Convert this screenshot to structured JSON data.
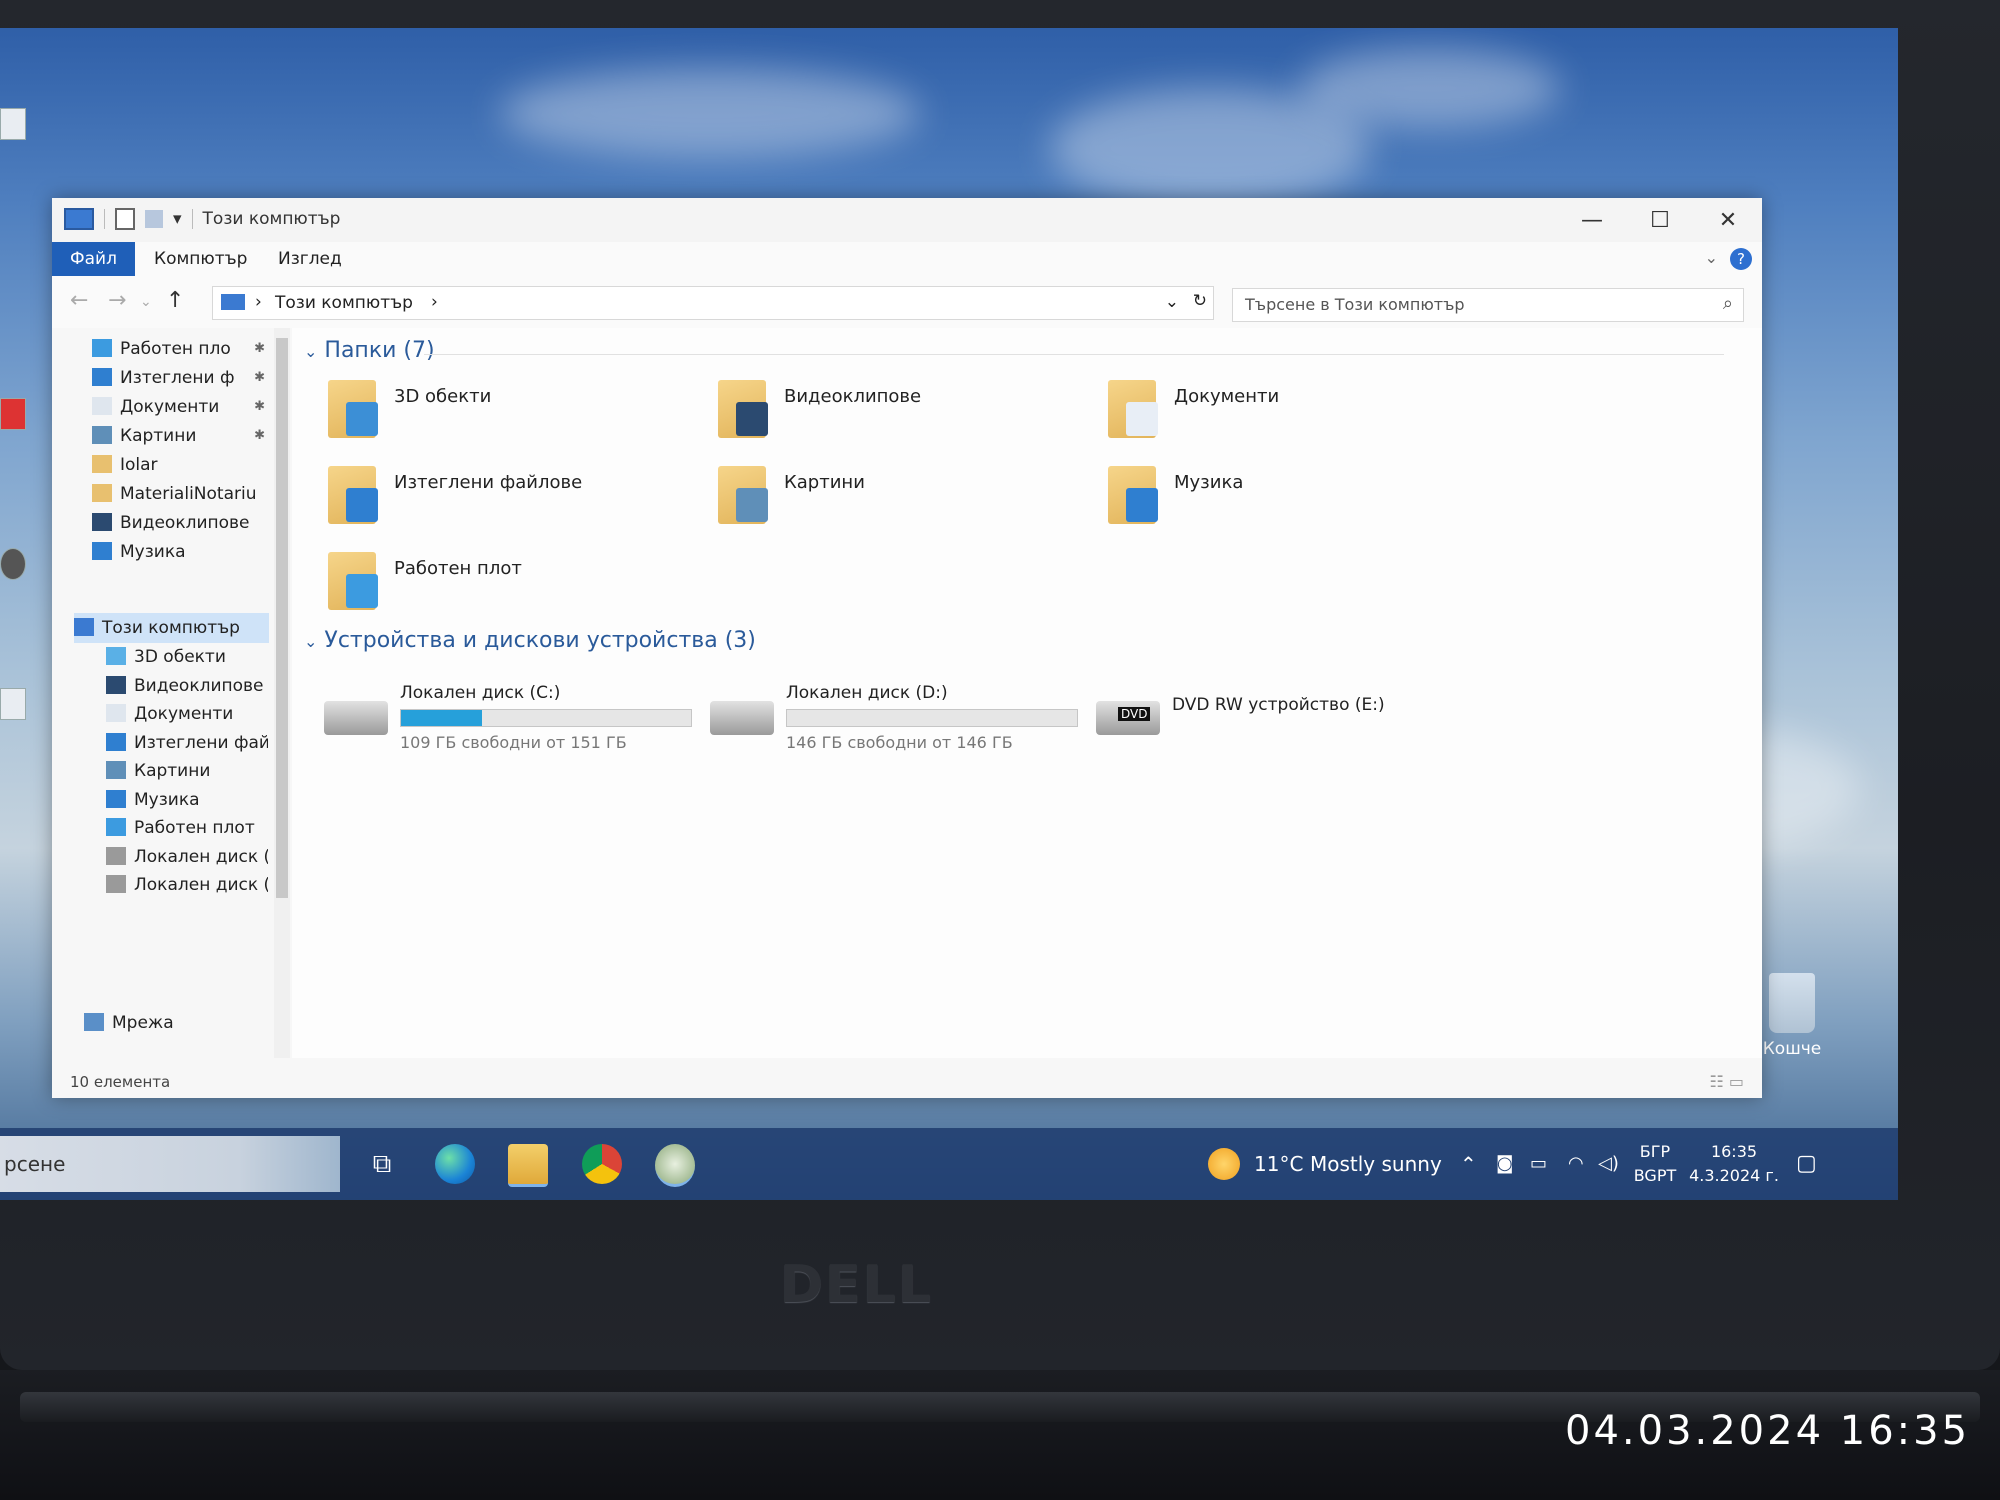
{
  "window": {
    "title": "Този компютър",
    "controls": {
      "minimize": "—",
      "maximize": "☐",
      "close": "✕"
    }
  },
  "ribbon": {
    "tabs": [
      "Файл",
      "Компютър",
      "Изглед"
    ],
    "help": "?"
  },
  "address": {
    "path": "Този компютър",
    "search_placeholder": "Търсене в Този компютър"
  },
  "sidebar": {
    "quick_access": [
      {
        "label": "Работен пло",
        "icon": "desktop-icon",
        "pinned": true
      },
      {
        "label": "Изтеглени ф",
        "icon": "download-icon",
        "pinned": true
      },
      {
        "label": "Документи",
        "icon": "documents-icon",
        "pinned": true
      },
      {
        "label": "Картини",
        "icon": "pictures-icon",
        "pinned": true
      },
      {
        "label": "Iolar",
        "icon": "folder-icon",
        "pinned": false
      },
      {
        "label": "MaterialiNotariu",
        "icon": "folder-icon",
        "pinned": false
      },
      {
        "label": "Видеоклипове",
        "icon": "videos-icon",
        "pinned": false
      },
      {
        "label": "Музика",
        "icon": "music-icon",
        "pinned": false
      }
    ],
    "this_pc": "Този компютър",
    "this_pc_items": [
      {
        "label": "3D обекти",
        "icon": "3d-objects-icon"
      },
      {
        "label": "Видеоклипове",
        "icon": "videos-icon"
      },
      {
        "label": "Документи",
        "icon": "documents-icon"
      },
      {
        "label": "Изтеглени файл",
        "icon": "download-icon"
      },
      {
        "label": "Картини",
        "icon": "pictures-icon"
      },
      {
        "label": "Музика",
        "icon": "music-icon"
      },
      {
        "label": "Работен плот",
        "icon": "desktop-icon"
      },
      {
        "label": "Локален диск (C",
        "icon": "drive-icon"
      },
      {
        "label": "Локален диск (D",
        "icon": "drive-icon"
      }
    ],
    "network": "Мрежа"
  },
  "folders": {
    "header": "Папки (7)",
    "items": [
      {
        "label": "3D обекти",
        "icon": "3d-objects-folder-icon",
        "badge": "#3c8fd6"
      },
      {
        "label": "Видеоклипове",
        "icon": "videos-folder-icon",
        "badge": "#2b4a70"
      },
      {
        "label": "Документи",
        "icon": "documents-folder-icon",
        "badge": "#e8eef6"
      },
      {
        "label": "Изтеглени файлове",
        "icon": "downloads-folder-icon",
        "badge": "#2f7fd0"
      },
      {
        "label": "Картини",
        "icon": "pictures-folder-icon",
        "badge": "#5f8fb8"
      },
      {
        "label": "Музика",
        "icon": "music-folder-icon",
        "badge": "#2f7fd0"
      },
      {
        "label": "Работен плот",
        "icon": "desktop-folder-icon",
        "badge": "#3c9be0"
      }
    ]
  },
  "devices": {
    "header": "Устройства и дискови устройства (3)",
    "items": [
      {
        "name": "Локален диск (C:)",
        "free": "109 ГБ свободни от 151 ГБ",
        "used_fraction": 0.28,
        "icon": "windows-drive-icon"
      },
      {
        "name": "Локален диск (D:)",
        "free": "146 ГБ свободни от 146 ГБ",
        "used_fraction": 0.0,
        "icon": "drive-icon"
      },
      {
        "name": "DVD RW устройство (E:)",
        "free": "",
        "used_fraction": null,
        "icon": "dvd-drive-icon",
        "badge_text": "DVD"
      }
    ]
  },
  "status": {
    "count": "10 елемента"
  },
  "desktop": {
    "recycle_bin": "Кошче"
  },
  "taskbar": {
    "search_text": "рсене",
    "weather_temp": "11°C",
    "weather_desc": "Mostly sunny",
    "language_top": "БГР",
    "language_bottom": "BGPT",
    "time": "16:35",
    "date": "4.3.2024 г."
  },
  "laptop": {
    "brand": "DELL"
  },
  "photo": {
    "timestamp": "04.03.2024  16:35"
  },
  "colors": {
    "accent": "#1f5fb8",
    "progress": "#26a0da",
    "folder": "#e8c06f"
  }
}
